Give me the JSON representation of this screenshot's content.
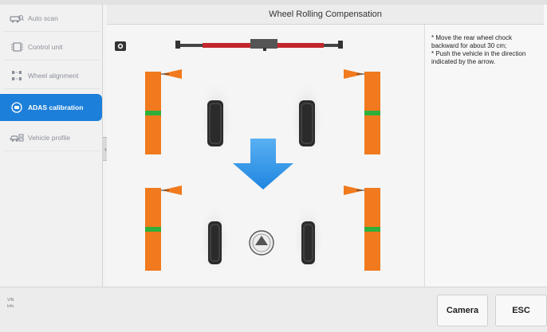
{
  "title": "Wheel Rolling Compensation",
  "sidebar": {
    "items": [
      {
        "label": "Auto scan",
        "icon": "car-scan-icon"
      },
      {
        "label": "Control unit",
        "icon": "control-unit-icon"
      },
      {
        "label": "Wheel alignment",
        "icon": "wheel-alignment-icon"
      },
      {
        "label": "ADAS calibration",
        "icon": "adas-icon"
      },
      {
        "label": "Vehicle profile",
        "icon": "vehicle-profile-icon"
      }
    ],
    "active_index": 3
  },
  "instructions": [
    "* Move the rear wheel chock backward for about 30 cm;",
    "* Push the vehicle in the direction indicated by the arrow."
  ],
  "bottom": {
    "vin_label": "VIN",
    "info_label": "Info",
    "camera_label": "Camera",
    "esc_label": "ESC"
  },
  "colors": {
    "accent": "#1c7fd9",
    "target_orange": "#f07a1d",
    "stripe_green": "#2fae3c",
    "arrow_blue": "#2a93ea"
  }
}
